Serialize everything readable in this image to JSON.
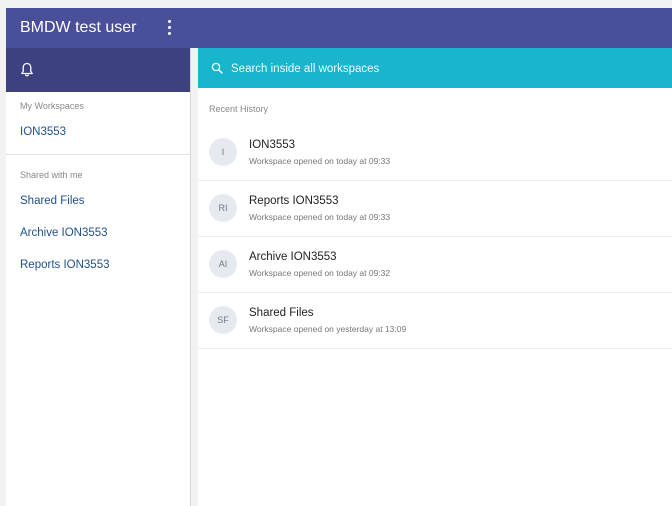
{
  "user": {
    "name": "BMDW test user"
  },
  "sidebar": {
    "sections": [
      {
        "label": "My Workspaces",
        "items": [
          {
            "label": "ION3553"
          }
        ]
      },
      {
        "label": "Shared with me",
        "items": [
          {
            "label": "Shared Files"
          },
          {
            "label": "Archive ION3553"
          },
          {
            "label": "Reports ION3553"
          }
        ]
      }
    ]
  },
  "search": {
    "placeholder": "Search inside all workspaces"
  },
  "main": {
    "recent_label": "Recent History",
    "history": [
      {
        "initials": "I",
        "title": "ION3553",
        "subtitle": "Workspace opened on today at 09:33"
      },
      {
        "initials": "RI",
        "title": "Reports ION3553",
        "subtitle": "Workspace opened on today at 09:33"
      },
      {
        "initials": "AI",
        "title": "Archive ION3553",
        "subtitle": "Workspace opened on today at 09:32"
      },
      {
        "initials": "SF",
        "title": "Shared Files",
        "subtitle": "Workspace opened on yesterday at 13:09"
      }
    ]
  },
  "colors": {
    "header": "#4a4f9a",
    "notification_bar": "#3d4180",
    "search_bar": "#18b5cc",
    "link": "#1f4f8a"
  },
  "icons": {
    "menu": "kebab-menu-icon",
    "notifications": "bell-icon",
    "search": "search-icon"
  }
}
